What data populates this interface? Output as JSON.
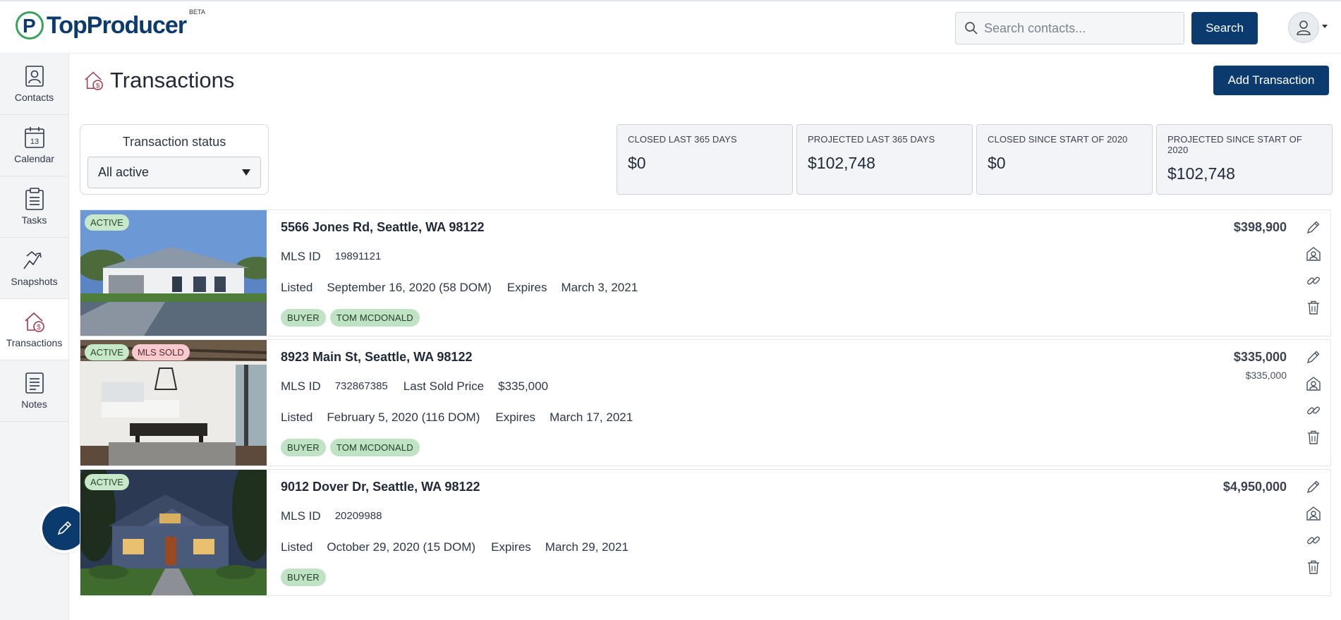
{
  "header": {
    "logo_text": "TopProducer",
    "logo_beta": "BETA",
    "search_placeholder": "Search contacts...",
    "search_button": "Search"
  },
  "sidebar": {
    "items": [
      {
        "label": "Contacts",
        "icon": "contacts-icon"
      },
      {
        "label": "Calendar",
        "icon": "calendar-icon",
        "day": "13"
      },
      {
        "label": "Tasks",
        "icon": "tasks-icon"
      },
      {
        "label": "Snapshots",
        "icon": "snapshots-icon"
      },
      {
        "label": "Transactions",
        "icon": "transactions-icon",
        "active": true
      },
      {
        "label": "Notes",
        "icon": "notes-icon"
      }
    ]
  },
  "page": {
    "title": "Transactions",
    "add_button": "Add Transaction"
  },
  "filter": {
    "label": "Transaction status",
    "selected": "All active"
  },
  "stats": [
    {
      "label": "CLOSED LAST 365 DAYS",
      "value": "$0"
    },
    {
      "label": "PROJECTED LAST 365 DAYS",
      "value": "$102,748"
    },
    {
      "label": "CLOSED SINCE START OF 2020",
      "value": "$0"
    },
    {
      "label": "PROJECTED SINCE START OF 2020",
      "value": "$102,748"
    }
  ],
  "labels": {
    "mls_id": "MLS ID",
    "listed": "Listed",
    "expires": "Expires",
    "last_sold_price": "Last Sold Price"
  },
  "transactions": [
    {
      "badges": [
        "ACTIVE"
      ],
      "address": "5566 Jones Rd, Seattle, WA 98122",
      "mls_id": "19891121",
      "listed": "September 16, 2020 (58 DOM)",
      "expires": "March 3, 2021",
      "chips": [
        "BUYER",
        "TOM MCDONALD"
      ],
      "price": "$398,900"
    },
    {
      "badges": [
        "ACTIVE",
        "MLS SOLD"
      ],
      "address": "8923 Main St, Seattle, WA 98122",
      "mls_id": "732867385",
      "last_sold_price": "$335,000",
      "listed": "February 5, 2020 (116 DOM)",
      "expires": "March 17, 2021",
      "chips": [
        "BUYER",
        "TOM MCDONALD"
      ],
      "price": "$335,000",
      "sub_price": "$335,000"
    },
    {
      "badges": [
        "ACTIVE"
      ],
      "address": "9012 Dover Dr, Seattle, WA 98122",
      "mls_id": "20209988",
      "listed": "October 29, 2020 (15 DOM)",
      "expires": "March 29, 2021",
      "chips": [
        "BUYER"
      ],
      "price": "$4,950,000"
    }
  ],
  "colors": {
    "primary": "#0b3a6e",
    "active_badge": "#c7e8c9",
    "sold_badge": "#f8c9cf",
    "chip": "#bfe3c4"
  }
}
